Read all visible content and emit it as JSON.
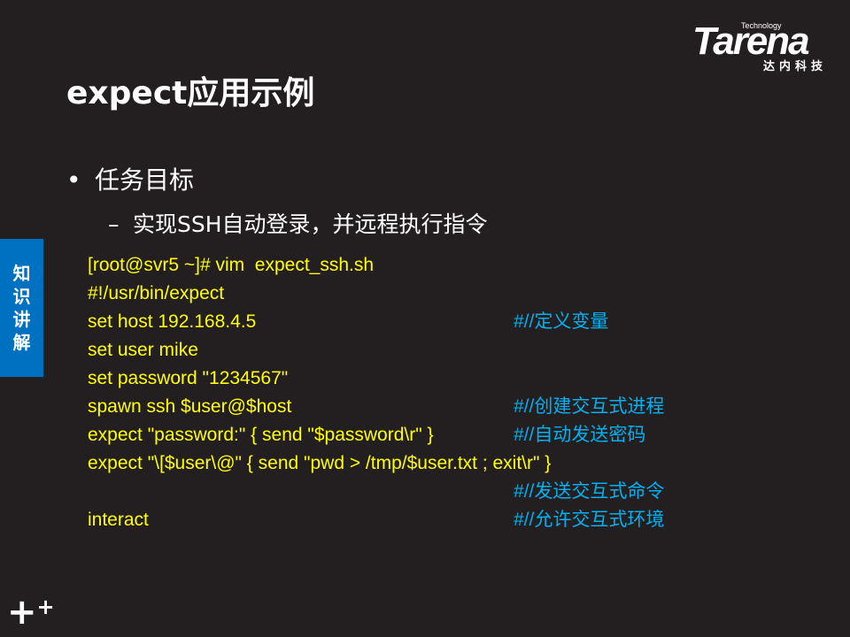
{
  "logo": {
    "tech": "Technology",
    "brand": "Tarena",
    "cn": "达内科技"
  },
  "title": "expect应用示例",
  "bullet1": {
    "marker": "•",
    "text": "任务目标"
  },
  "bullet2": {
    "marker": "–",
    "text": "实现SSH自动登录，并远程执行指令"
  },
  "side_tab": [
    "知",
    "识",
    "讲",
    "解"
  ],
  "code": [
    {
      "code": "[root@svr5 ~]# vim  expect_ssh.sh",
      "comment": ""
    },
    {
      "code": "#!/usr/bin/expect",
      "comment": ""
    },
    {
      "code": "set host 192.168.4.5",
      "comment": "#//定义变量"
    },
    {
      "code": "set user mike",
      "comment": ""
    },
    {
      "code": "set password \"1234567\"",
      "comment": ""
    },
    {
      "code": "spawn ssh $user@$host",
      "comment": "#//创建交互式进程"
    },
    {
      "code": "expect \"password:\" { send \"$password\\r\" }",
      "comment": "#//自动发送密码"
    },
    {
      "code": "expect \"\\[$user\\@\" { send \"pwd > /tmp/$user.txt ; exit\\r\" }",
      "comment": ""
    },
    {
      "code": "",
      "comment": "#//发送交互式命令"
    },
    {
      "code": "interact",
      "comment": "#//允许交互式环境"
    }
  ],
  "colors": {
    "background": "#231f20",
    "code": "#ffff00",
    "comment": "#00b0f0",
    "side_tab": "#0070c0"
  },
  "footer_icon": "plus-plus-icon"
}
